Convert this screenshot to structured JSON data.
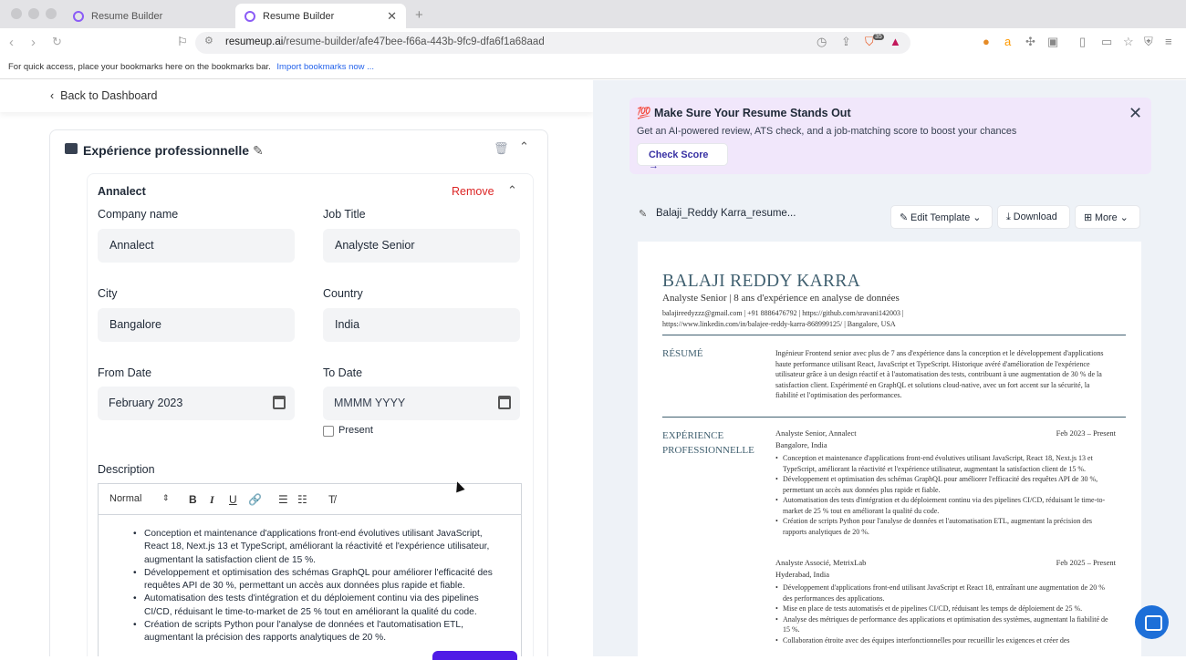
{
  "browser": {
    "tabs": [
      {
        "label": "Resume Builder"
      },
      {
        "label": "Resume Builder"
      }
    ],
    "url_host": "resumeup.ai",
    "url_path": "/resume-builder/afe47bee-f66a-443b-9fc9-dfa6f1a68aad",
    "bookmarks_text": "For quick access, place your bookmarks here on the bookmarks bar.",
    "bookmarks_link": "Import bookmarks now ...",
    "badge": "35"
  },
  "editor": {
    "back": "Back to Dashboard",
    "section_title": "Expérience professionnelle",
    "entry_name": "Annalect",
    "remove": "Remove",
    "labels": {
      "company": "Company name",
      "job": "Job Title",
      "city": "City",
      "country": "Country",
      "from": "From Date",
      "to": "To Date",
      "present": "Present",
      "description": "Description"
    },
    "values": {
      "company": "Annalect",
      "job": "Analyste Senior",
      "city": "Bangalore",
      "country": "India",
      "from": "February 2023",
      "to_placeholder": "MMMM YYYY"
    },
    "toolbar": {
      "style": "Normal",
      "bold": "B",
      "italic": "I",
      "underline": "U"
    },
    "bullets": [
      "Conception et maintenance d'applications front-end évolutives utilisant JavaScript, React 18, Next.js 13 et TypeScript, améliorant la réactivité et l'expérience utilisateur, augmentant la satisfaction client de 15 %.",
      "Développement et optimisation des schémas GraphQL pour améliorer l'efficacité des requêtes API de 30 %, permettant un accès aux données plus rapide et fiable.",
      "Automatisation des tests d'intégration et du déploiement continu via des pipelines CI/CD, réduisant le time-to-market de 25 % tout en améliorant la qualité du code.",
      "Création de scripts Python pour l'analyse de données et l'automatisation ETL, augmentant la précision des rapports analytiques de 20 %."
    ]
  },
  "preview": {
    "promo_title": "💯 Make Sure Your Resume Stands Out",
    "promo_sub": "Get an AI-powered review, ATS check, and a job-matching score to boost your chances",
    "check_score": "Check Score →",
    "file_name": "Balaji_Reddy Karra_resume...",
    "edit_template": "Edit Template",
    "download": "Download",
    "more": "More",
    "resume": {
      "name": "BALAJI REDDY KARRA",
      "subtitle": "Analyste Senior | 8 ans d'expérience en analyse de données",
      "contact1": "balajireedyzzz@gmail.com  |  +91 8886476792  |  https://github.com/sravani142003  |",
      "contact2": "https://www.linkedin.com/in/balajee-reddy-karra-868999125/  |  Bangalore, USA",
      "summary_title": "RÉSUMÉ",
      "summary": "Ingénieur Frontend senior avec plus de 7 ans d'expérience dans la conception et le développement d'applications haute performance utilisant React, JavaScript et TypeScript. Historique avéré d'amélioration de l'expérience utilisateur grâce à un design réactif et à l'automatisation des tests, contribuant à une augmentation de 30 % de la satisfaction client. Expérimenté en GraphQL et solutions cloud-native, avec un fort accent sur la sécurité, la fiabilité et l'optimisation des performances.",
      "exp_title1": "EXPÉRIENCE",
      "exp_title2": "PROFESSIONNELLE",
      "job1": {
        "title": "Analyste Senior, Annalect",
        "place": "Bangalore, India",
        "date": "Feb 2023 – Present",
        "bullets": [
          "Conception et maintenance d'applications front-end évolutives utilisant JavaScript, React 18, Next.js 13 et TypeScript, améliorant la réactivité et l'expérience utilisateur, augmentant la satisfaction client de 15 %.",
          "Développement et optimisation des schémas GraphQL pour améliorer l'efficacité des requêtes API de 30 %, permettant un accès aux données plus rapide et fiable.",
          "Automatisation des tests d'intégration et du déploiement continu via des pipelines CI/CD, réduisant le time-to-market de 25 % tout en améliorant la qualité du code.",
          "Création de scripts Python pour l'analyse de données et l'automatisation ETL, augmentant la précision des rapports analytiques de 20 %."
        ]
      },
      "job2": {
        "title": "Analyste Associé, MetrixLab",
        "place": "Hyderabad, India",
        "date": "Feb 2025 – Present",
        "bullets": [
          "Développement d'applications front-end utilisant JavaScript et React 18, entraînant une augmentation de 20 % des performances des applications.",
          "Mise en place de tests automatisés et de pipelines CI/CD, réduisant les temps de déploiement de 25 %.",
          "Analyse des métriques de performance des applications et optimisation des systèmes, augmentant la fiabilité de 15 %.",
          "Collaboration étroite avec des équipes interfonctionnelles pour recueillir les exigences et créer des"
        ]
      }
    }
  }
}
